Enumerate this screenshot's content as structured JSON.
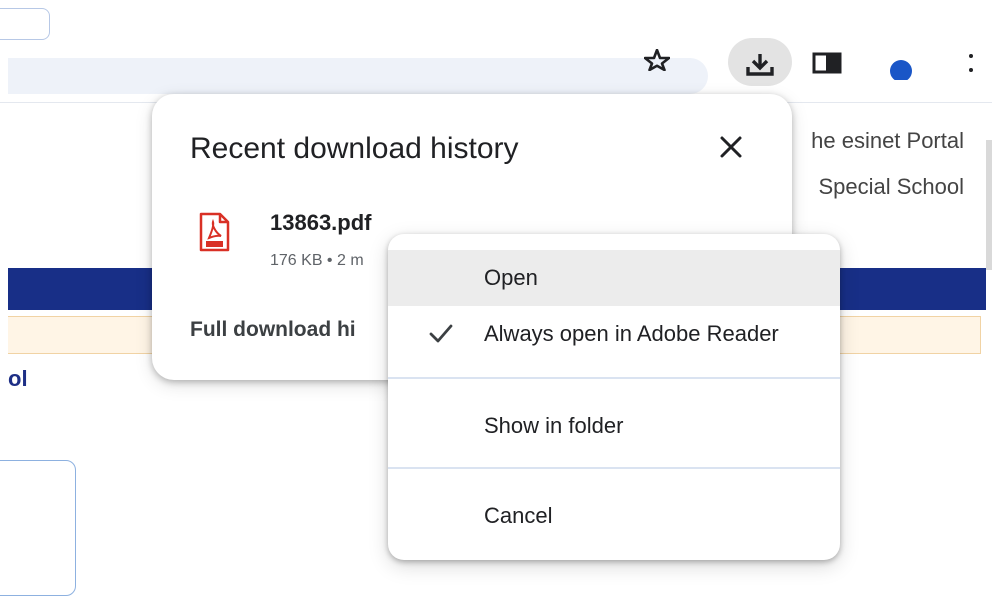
{
  "browser": {
    "icons": [
      "star-icon",
      "download-icon",
      "side-panel-icon",
      "profile-avatar",
      "more-menu-icon"
    ]
  },
  "page": {
    "portal_line_1": "he esinet Portal",
    "portal_line_2": "Special School",
    "school_heading": "ol",
    "colors": {
      "nav_band": "#182f87",
      "notice_bg": "#fff5e6",
      "notice_border": "#f1d3a4",
      "heading": "#1e2f86"
    }
  },
  "download_panel": {
    "title": "Recent download history",
    "close_icon": "close-icon",
    "item": {
      "icon": "pdf-file-icon",
      "file_name": "13863.pdf",
      "meta": "176 KB • 2 m"
    },
    "full_history_label": "Full download hi"
  },
  "context_menu": {
    "items": [
      {
        "label": "Open",
        "highlighted": true,
        "checked": false
      },
      {
        "label": "Always open in Adobe Reader",
        "highlighted": false,
        "checked": true
      },
      {
        "label": "Show in folder",
        "highlighted": false,
        "checked": false
      },
      {
        "label": "Cancel",
        "highlighted": false,
        "checked": false
      }
    ],
    "check_icon": "checkmark-icon",
    "highlight_color": "#ececec",
    "divider_color": "#dae3f1"
  },
  "pdf_icon_color": "#d93025"
}
